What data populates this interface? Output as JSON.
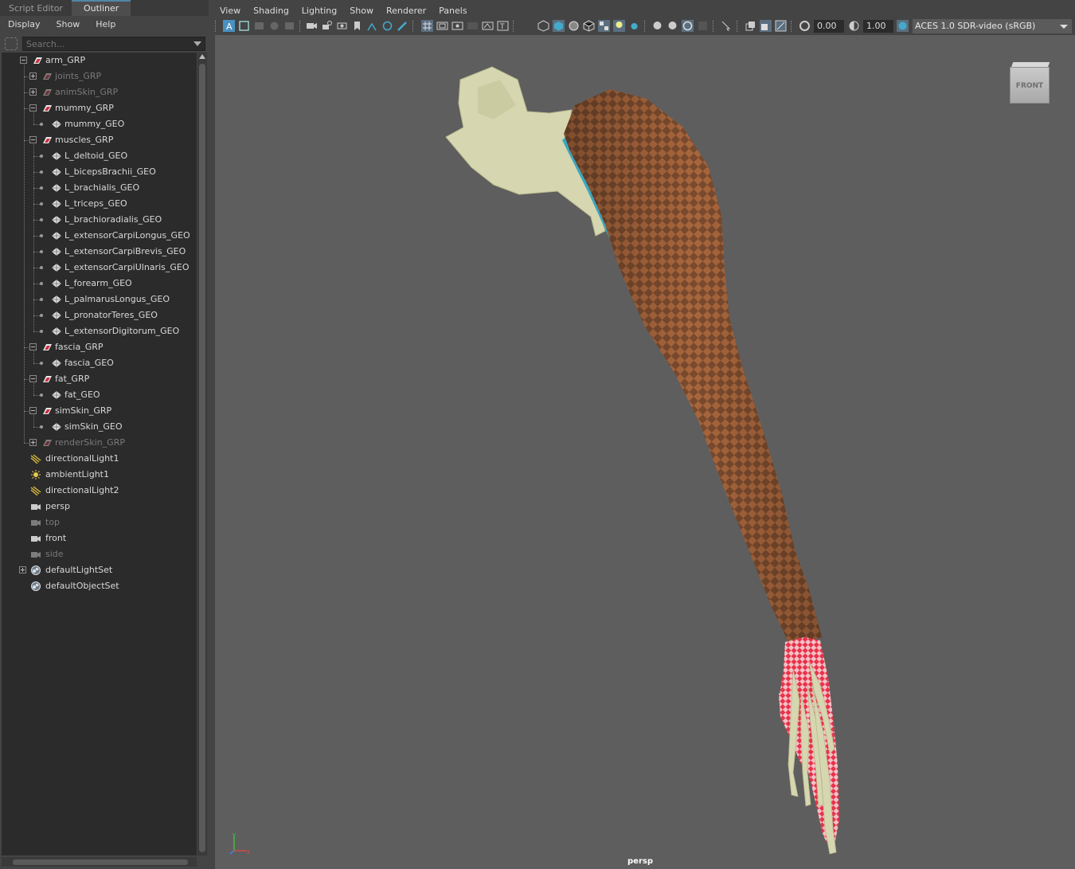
{
  "outliner_tabs": {
    "script_editor": "Script Editor",
    "outliner": "Outliner"
  },
  "outliner_menu": {
    "display": "Display",
    "show": "Show",
    "help": "Help"
  },
  "search": {
    "placeholder": "Search..."
  },
  "tree": [
    {
      "label": "arm_GRP",
      "icon": "group-icon",
      "depth": 0,
      "expand": "minus",
      "dim": false
    },
    {
      "label": "joints_GRP",
      "icon": "group-icon",
      "depth": 1,
      "expand": "plus",
      "dim": true
    },
    {
      "label": "animSkin_GRP",
      "icon": "group-icon",
      "depth": 1,
      "expand": "plus",
      "dim": true
    },
    {
      "label": "mummy_GRP",
      "icon": "group-icon",
      "depth": 1,
      "expand": "minus",
      "dim": false
    },
    {
      "label": "mummy_GEO",
      "icon": "mesh-icon",
      "depth": 2,
      "expand": "dot",
      "dim": false
    },
    {
      "label": "muscles_GRP",
      "icon": "group-icon",
      "depth": 1,
      "expand": "minus",
      "dim": false
    },
    {
      "label": "L_deltoid_GEO",
      "icon": "mesh-icon",
      "depth": 2,
      "expand": "dot",
      "dim": false
    },
    {
      "label": "L_bicepsBrachii_GEO",
      "icon": "mesh-icon",
      "depth": 2,
      "expand": "dot",
      "dim": false
    },
    {
      "label": "L_brachialis_GEO",
      "icon": "mesh-icon",
      "depth": 2,
      "expand": "dot",
      "dim": false
    },
    {
      "label": "L_triceps_GEO",
      "icon": "mesh-icon",
      "depth": 2,
      "expand": "dot",
      "dim": false
    },
    {
      "label": "L_brachioradialis_GEO",
      "icon": "mesh-icon",
      "depth": 2,
      "expand": "dot",
      "dim": false
    },
    {
      "label": "L_extensorCarpiLongus_GEO",
      "icon": "mesh-icon",
      "depth": 2,
      "expand": "dot",
      "dim": false
    },
    {
      "label": "L_extensorCarpiBrevis_GEO",
      "icon": "mesh-icon",
      "depth": 2,
      "expand": "dot",
      "dim": false
    },
    {
      "label": "L_extensorCarpiUlnaris_GEO",
      "icon": "mesh-icon",
      "depth": 2,
      "expand": "dot",
      "dim": false
    },
    {
      "label": "L_forearm_GEO",
      "icon": "mesh-icon",
      "depth": 2,
      "expand": "dot",
      "dim": false
    },
    {
      "label": "L_palmarusLongus_GEO",
      "icon": "mesh-icon",
      "depth": 2,
      "expand": "dot",
      "dim": false
    },
    {
      "label": "L_pronatorTeres_GEO",
      "icon": "mesh-icon",
      "depth": 2,
      "expand": "dot",
      "dim": false
    },
    {
      "label": "L_extensorDigitorum_GEO",
      "icon": "mesh-icon",
      "depth": 2,
      "expand": "dot",
      "dim": false
    },
    {
      "label": "fascia_GRP",
      "icon": "group-icon",
      "depth": 1,
      "expand": "minus",
      "dim": false
    },
    {
      "label": "fascia_GEO",
      "icon": "mesh-icon",
      "depth": 2,
      "expand": "dot",
      "dim": false
    },
    {
      "label": "fat_GRP",
      "icon": "group-icon",
      "depth": 1,
      "expand": "minus",
      "dim": false
    },
    {
      "label": "fat_GEO",
      "icon": "mesh-icon",
      "depth": 2,
      "expand": "dot",
      "dim": false
    },
    {
      "label": "simSkin_GRP",
      "icon": "group-icon",
      "depth": 1,
      "expand": "minus",
      "dim": false
    },
    {
      "label": "simSkin_GEO",
      "icon": "mesh-icon",
      "depth": 2,
      "expand": "dot",
      "dim": false
    },
    {
      "label": "renderSkin_GRP",
      "icon": "group-icon",
      "depth": 1,
      "expand": "plus",
      "dim": true
    },
    {
      "label": "directionalLight1",
      "icon": "directional-light-icon",
      "depth": 0,
      "expand": "none",
      "dim": false
    },
    {
      "label": "ambientLight1",
      "icon": "ambient-light-icon",
      "depth": 0,
      "expand": "none",
      "dim": false
    },
    {
      "label": "directionalLight2",
      "icon": "directional-light-icon",
      "depth": 0,
      "expand": "none",
      "dim": false
    },
    {
      "label": "persp",
      "icon": "camera-icon",
      "depth": 0,
      "expand": "none",
      "dim": false
    },
    {
      "label": "top",
      "icon": "camera-icon",
      "depth": 0,
      "expand": "none",
      "dim": true
    },
    {
      "label": "front",
      "icon": "camera-icon",
      "depth": 0,
      "expand": "none",
      "dim": false
    },
    {
      "label": "side",
      "icon": "camera-icon",
      "depth": 0,
      "expand": "none",
      "dim": true
    },
    {
      "label": "defaultLightSet",
      "icon": "set-icon",
      "depth": 0,
      "expand": "plus-root",
      "dim": false
    },
    {
      "label": "defaultObjectSet",
      "icon": "set-icon",
      "depth": 0,
      "expand": "none",
      "dim": false
    }
  ],
  "viewport_menu": {
    "view": "View",
    "shading": "Shading",
    "lighting": "Lighting",
    "show": "Show",
    "renderer": "Renderer",
    "panels": "Panels"
  },
  "toolbar": {
    "exposure": "0.00",
    "gamma": "1.00",
    "color_space": "ACES 1.0 SDR-video (sRGB)"
  },
  "viewport": {
    "camera": "persp",
    "viewcube_face": "FRONT"
  },
  "colors": {
    "accent": "#5285a6",
    "checker_dark": "#7a4a2e",
    "checker_light": "#a8663c",
    "bone": "#d6d6b0",
    "hand_checker": "#e8334a"
  }
}
